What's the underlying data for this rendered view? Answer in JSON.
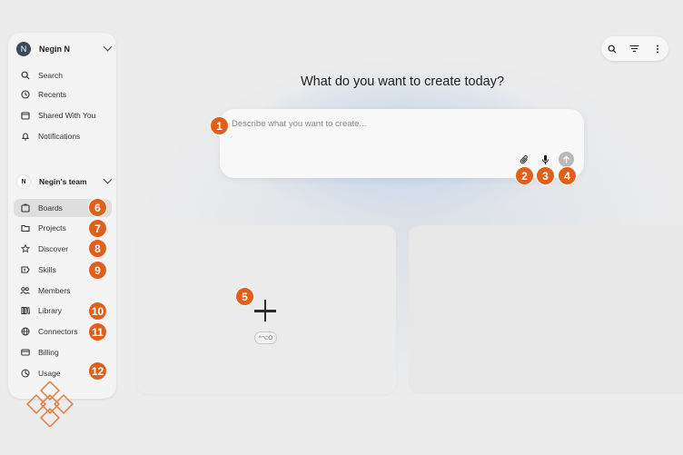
{
  "user": {
    "initial": "N",
    "name": "Negin N"
  },
  "nav_top": [
    {
      "label": "Search",
      "icon": "search-icon"
    },
    {
      "label": "Recents",
      "icon": "clock-icon"
    },
    {
      "label": "Shared With You",
      "icon": "inbox-icon"
    },
    {
      "label": "Notifications",
      "icon": "bell-icon"
    }
  ],
  "team": {
    "initial": "N",
    "name": "Negin's team"
  },
  "nav_team": [
    {
      "label": "Boards",
      "icon": "board-icon",
      "active": true
    },
    {
      "label": "Projects",
      "icon": "folder-icon"
    },
    {
      "label": "Discover",
      "icon": "star-icon"
    },
    {
      "label": "Skills",
      "icon": "skills-icon"
    },
    {
      "label": "Members",
      "icon": "members-icon"
    },
    {
      "label": "Library",
      "icon": "library-icon"
    },
    {
      "label": "Connectors",
      "icon": "globe-icon"
    },
    {
      "label": "Billing",
      "icon": "card-icon"
    },
    {
      "label": "Usage",
      "icon": "gauge-icon"
    }
  ],
  "main": {
    "headline": "What do you want to create today?",
    "prompt_placeholder": "Describe what you want to create...",
    "new_card_shortcut": "^⌥O"
  },
  "badges": [
    "1",
    "2",
    "3",
    "4",
    "5",
    "6",
    "7",
    "8",
    "9",
    "10",
    "11",
    "12"
  ],
  "colors": {
    "badge": "#e0601b",
    "accent_bg": "#cfdcec"
  }
}
